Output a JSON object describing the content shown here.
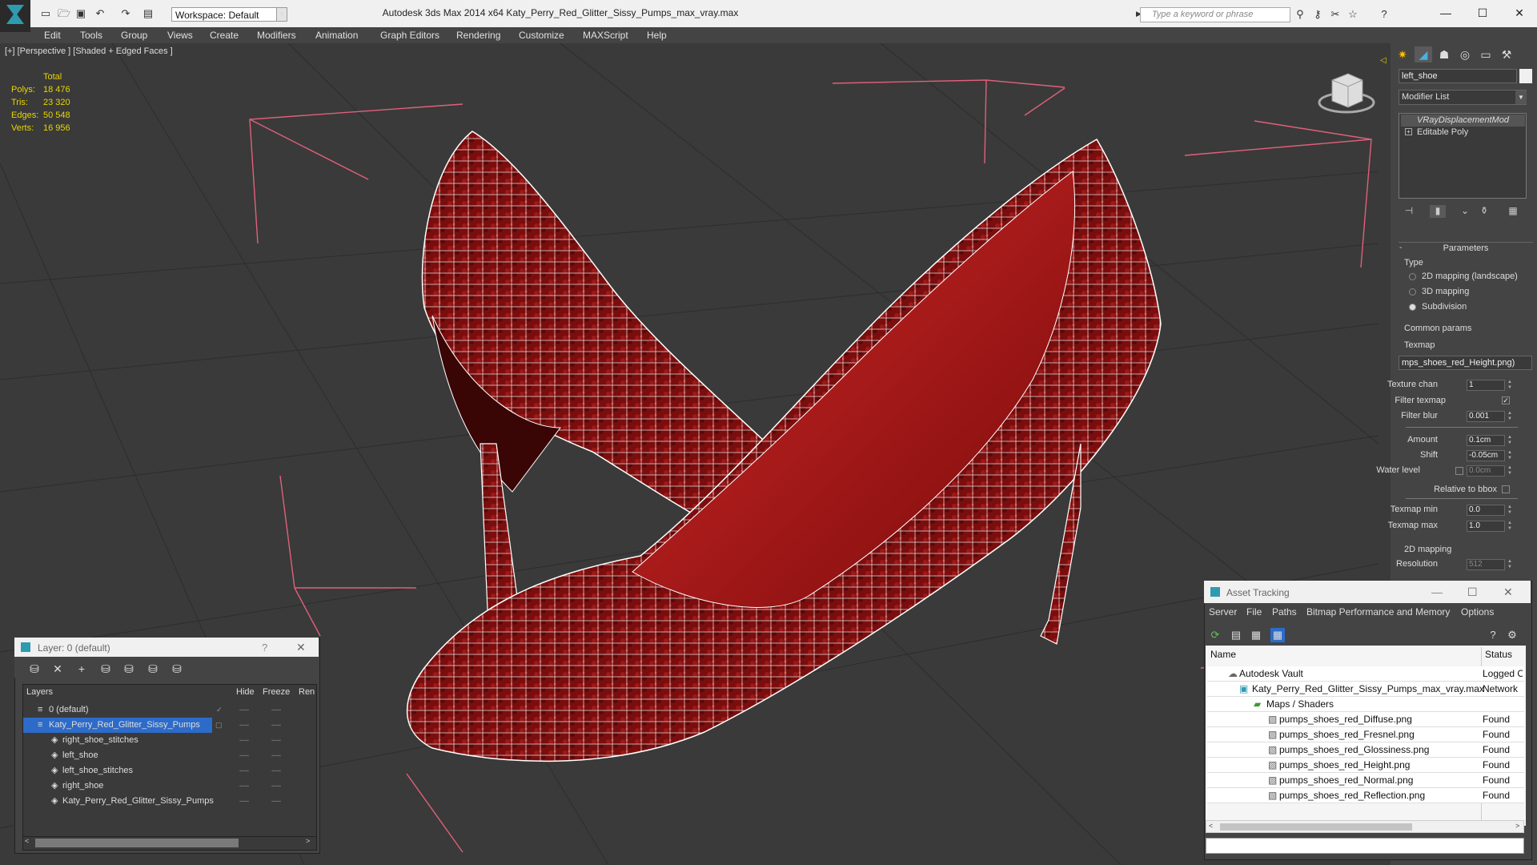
{
  "titlebar": {
    "workspace_label": "Workspace: Default",
    "title": "Autodesk 3ds Max  2014 x64      Katy_Perry_Red_Glitter_Sissy_Pumps_max_vray.max",
    "search_placeholder": "Type a keyword or phrase",
    "minimize": "—",
    "maximize": "☐",
    "close": "✕"
  },
  "menubar": [
    "Edit",
    "Tools",
    "Group",
    "Views",
    "Create",
    "Modifiers",
    "Animation",
    "Graph Editors",
    "Rendering",
    "Customize",
    "MAXScript",
    "Help"
  ],
  "viewport": {
    "label": "[+] [Perspective ] [Shaded + Edged Faces ]",
    "stats": {
      "header": "Total",
      "rows": [
        {
          "label": "Polys:",
          "value": "18 476"
        },
        {
          "label": "Tris:",
          "value": "23 320"
        },
        {
          "label": "Edges:",
          "value": "50 548"
        },
        {
          "label": "Verts:",
          "value": "16 956"
        }
      ]
    },
    "colors": {
      "background": "#3a3a3a",
      "shoe": "#8a1010",
      "wire": "#ffffff",
      "bbox": "#e0607a",
      "stats": "#e8d600"
    }
  },
  "command_panel": {
    "object_name": "left_shoe",
    "modifier_list": "Modifier List",
    "stack": [
      "VRayDisplacementMod",
      "Editable Poly"
    ],
    "rollout": "Parameters",
    "type_group": "Type",
    "type_options": [
      {
        "label": "2D mapping (landscape)",
        "selected": false
      },
      {
        "label": "3D mapping",
        "selected": false
      },
      {
        "label": "Subdivision",
        "selected": true
      }
    ],
    "common_group": "Common params",
    "texmap_label": "Texmap",
    "texmap_value": "mps_shoes_red_Height.png)",
    "texture_chan_label": "Texture chan",
    "texture_chan_value": "1",
    "filter_texmap_label": "Filter texmap",
    "filter_blur_label": "Filter blur",
    "filter_blur_value": "0.001",
    "amount_label": "Amount",
    "amount_value": "0.1cm",
    "shift_label": "Shift",
    "shift_value": "-0.05cm",
    "water_level_label": "Water level",
    "water_level_value": "0.0cm",
    "relative_bbox_label": "Relative to bbox",
    "texmap_min_label": "Texmap min",
    "texmap_min_value": "0.0",
    "texmap_max_label": "Texmap max",
    "texmap_max_value": "1.0",
    "mapping2d_group": "2D mapping",
    "resolution_label": "Resolution",
    "resolution_value": "512"
  },
  "layer_dialog": {
    "title": "Layer: 0 (default)",
    "help": "?",
    "close": "✕",
    "columns": [
      "Layers",
      "Hide",
      "Freeze",
      "Ren"
    ],
    "rows": [
      "0 (default)",
      "Katy_Perry_Red_Glitter_Sissy_Pumps",
      "right_shoe_stitches",
      "left_shoe",
      "left_shoe_stitches",
      "right_shoe",
      "Katy_Perry_Red_Glitter_Sissy_Pumps"
    ]
  },
  "asset_dialog": {
    "title": "Asset Tracking",
    "menu": [
      "Server",
      "File",
      "Paths",
      "Bitmap Performance and Memory",
      "Options"
    ],
    "columns": [
      "Name",
      "Status"
    ],
    "rows": [
      {
        "name": "Autodesk Vault",
        "status": "Logged Out"
      },
      {
        "name": "Katy_Perry_Red_Glitter_Sissy_Pumps_max_vray.max",
        "status": "Network"
      },
      {
        "name": "Maps / Shaders",
        "status": ""
      },
      {
        "name": "pumps_shoes_red_Diffuse.png",
        "status": "Found"
      },
      {
        "name": "pumps_shoes_red_Fresnel.png",
        "status": "Found"
      },
      {
        "name": "pumps_shoes_red_Glossiness.png",
        "status": "Found"
      },
      {
        "name": "pumps_shoes_red_Height.png",
        "status": "Found"
      },
      {
        "name": "pumps_shoes_red_Normal.png",
        "status": "Found"
      },
      {
        "name": "pumps_shoes_red_Reflection.png",
        "status": "Found"
      }
    ]
  }
}
